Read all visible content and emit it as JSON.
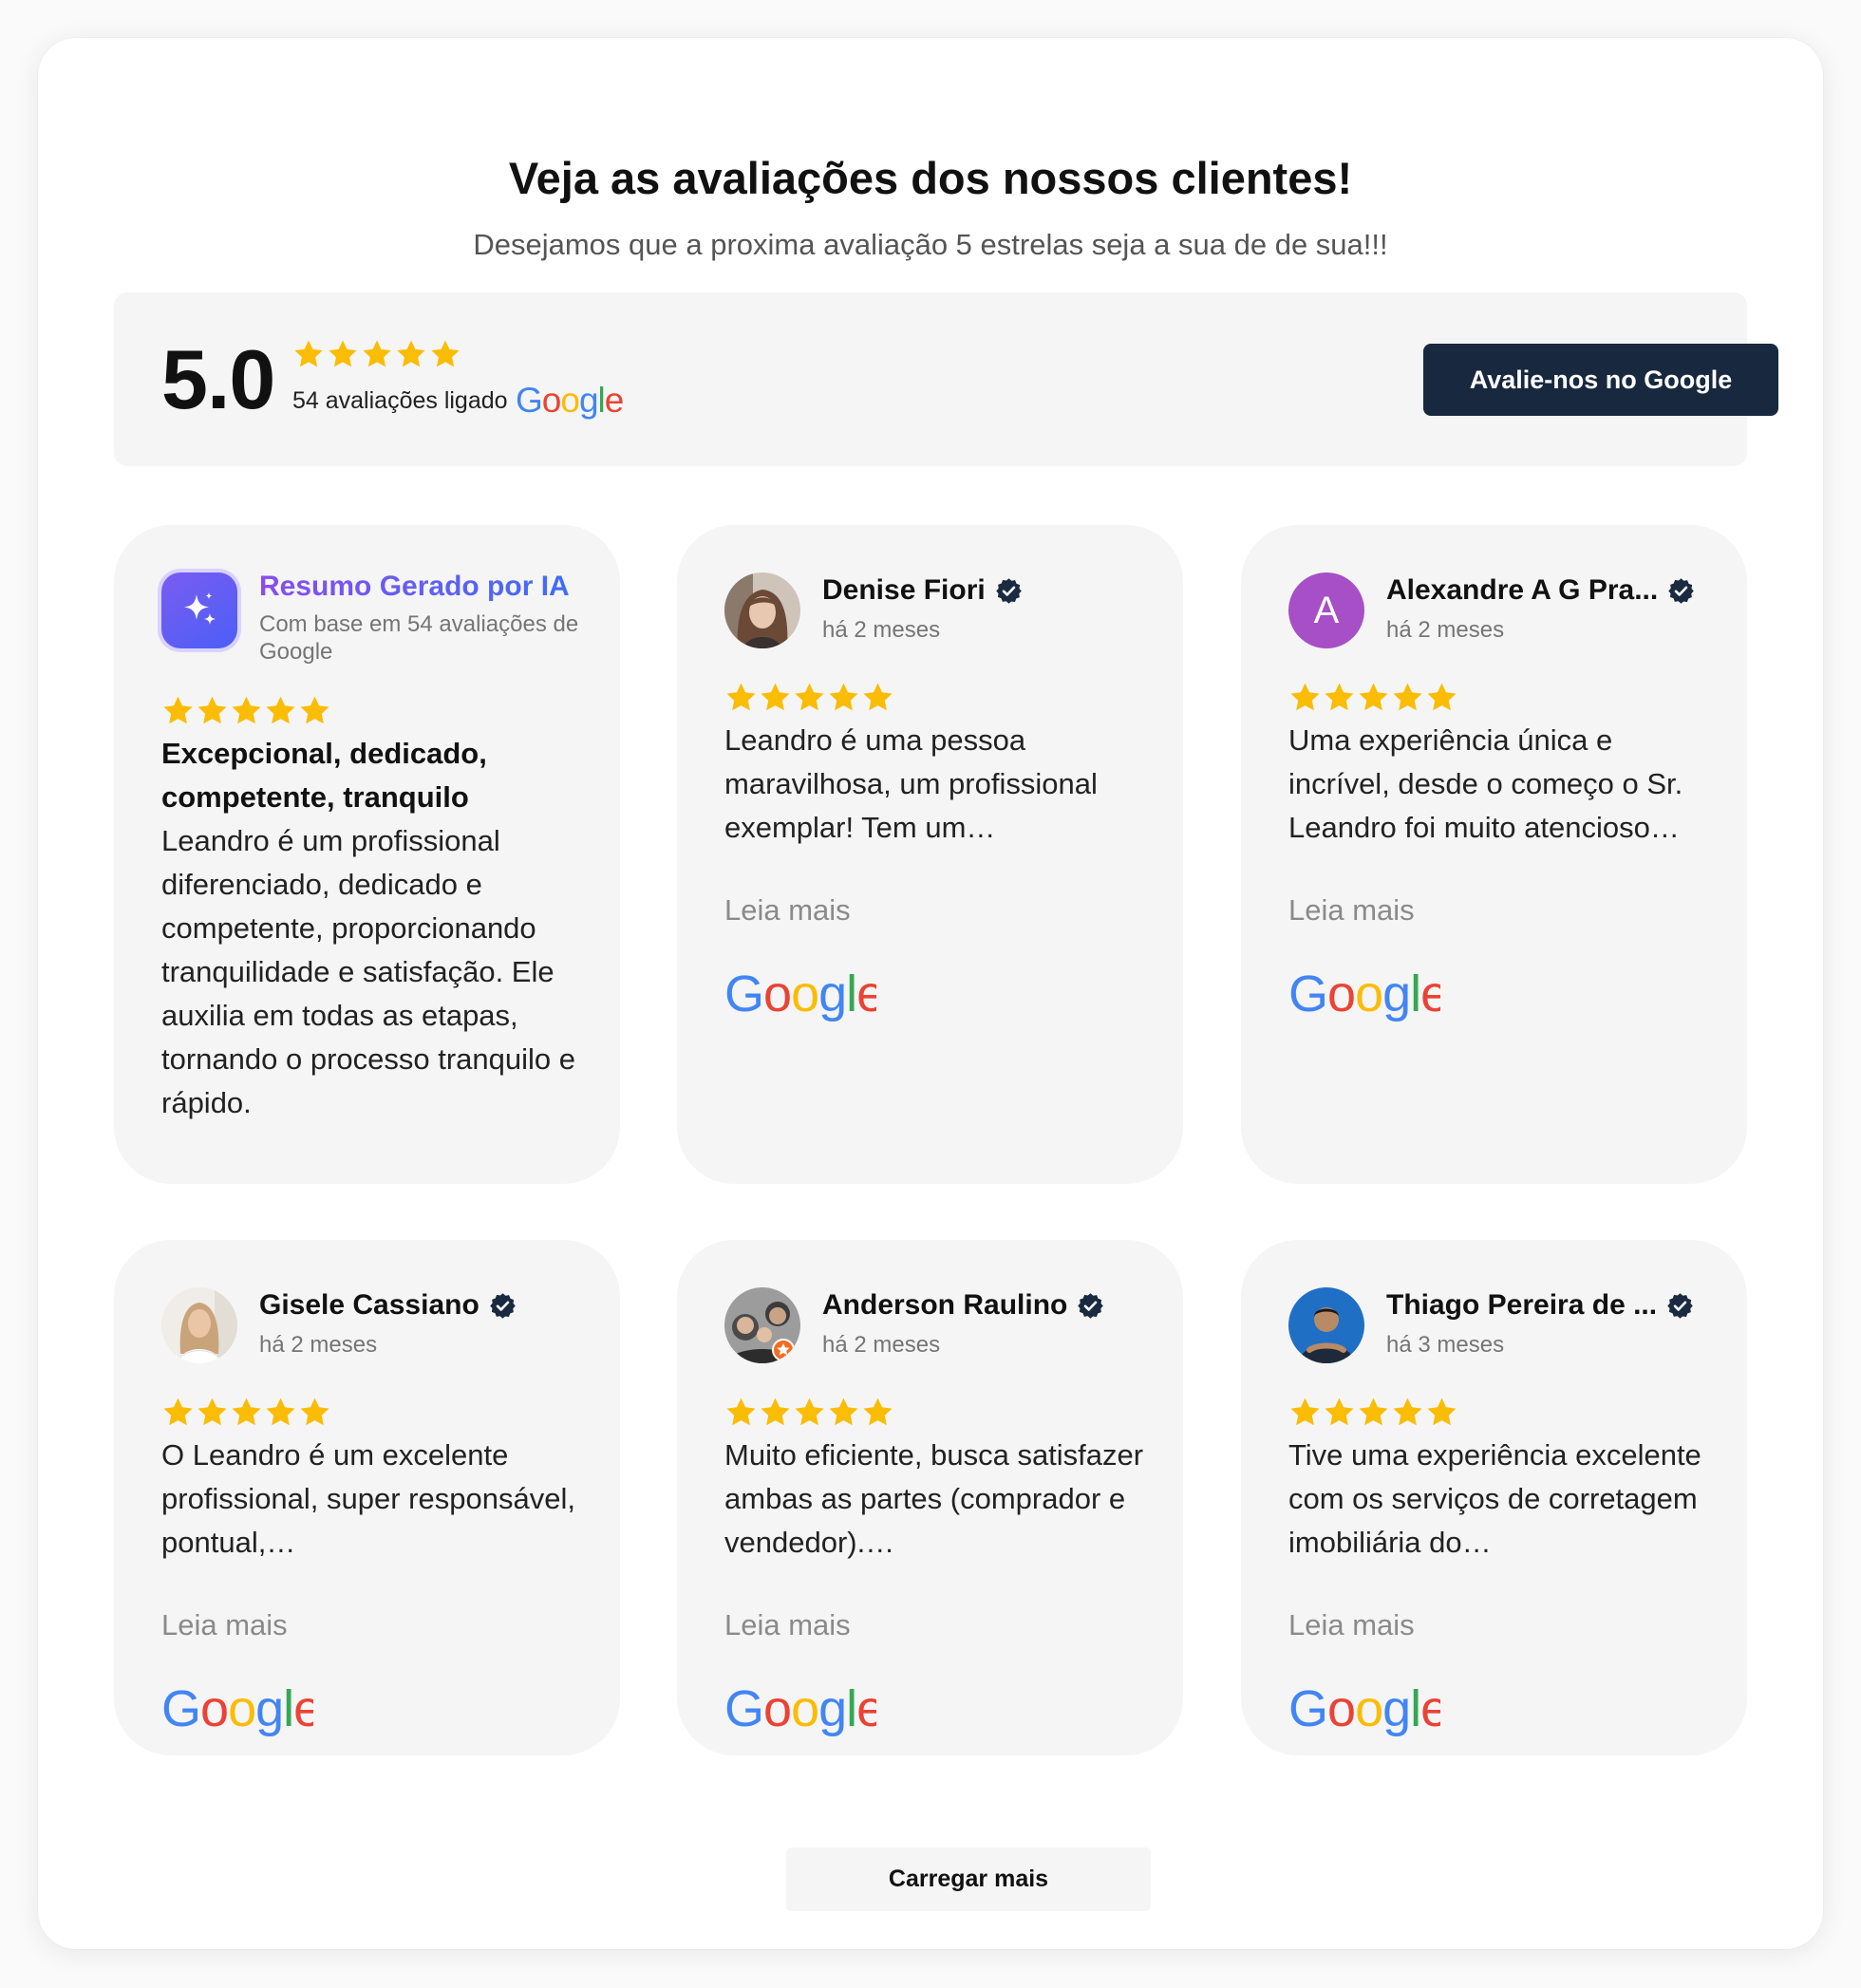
{
  "header": {
    "title": "Veja as avaliações dos nossos clientes!",
    "subtitle": "Desejamos que a proxima avaliação 5 estrelas seja a sua de de sua!!!"
  },
  "summary": {
    "rating": "5.0",
    "stars": 5,
    "count_text": "54 avaliações ligado",
    "platform": "Google",
    "cta_label": "Avalie-nos no Google"
  },
  "ai_summary": {
    "title": "Resumo Gerado por IA",
    "subtitle": "Com base em 54 avaliações de Google",
    "stars": 5,
    "headline": "Excepcional, dedicado, competente, tranquilo",
    "body": "Leandro é um profissional diferenciado, dedicado e competente, proporcionando tranquilidade e satisfação. Ele auxilia em todas as etapas, tornando o processo tranquilo e rápido."
  },
  "reviews": [
    {
      "name": "Denise Fiori",
      "date": "há 2 meses",
      "stars": 5,
      "text": "Leandro é uma pessoa maravilhosa, um profissional exemplar! Tem um…",
      "read_more": "Leia mais",
      "avatar": "photo-woman-brown-hair",
      "verified": true
    },
    {
      "name": "Alexandre A G Pra...",
      "date": "há 2 meses",
      "stars": 5,
      "text": "Uma experiência única e incrível, desde o começo o Sr. Leandro foi muito atencioso…",
      "read_more": "Leia mais",
      "avatar_letter": "A",
      "avatar_color": "#a64fc7",
      "verified": true
    },
    {
      "name": "Gisele Cassiano",
      "date": "há 2 meses",
      "stars": 5,
      "text": "O Leandro é um excelente profissional, super responsável, pontual,…",
      "read_more": "Leia mais",
      "avatar": "photo-woman-smiling",
      "verified": true
    },
    {
      "name": "Anderson Raulino",
      "date": "há 2 meses",
      "stars": 5,
      "text": "Muito eficiente, busca satisfazer ambas as partes (comprador e vendedor).…",
      "read_more": "Leia mais",
      "avatar": "photo-family",
      "verified": true
    },
    {
      "name": "Thiago Pereira de ...",
      "date": "há 3 meses",
      "stars": 5,
      "text": "Tive uma experiência excelente com os serviços de corretagem imobiliária do…",
      "read_more": "Leia mais",
      "avatar": "photo-man-blue-background",
      "verified": true
    }
  ],
  "load_more_label": "Carregar mais",
  "colors": {
    "star": "#fbbc04",
    "cta_bg": "#17283f",
    "card_bg": "#f5f5f5",
    "google_blue": "#4285f4",
    "google_red": "#ea4335",
    "google_yellow": "#fbbc05",
    "google_green": "#34a853",
    "verified": "#1a2a40",
    "ai_gradient_start": "#8a4cf0",
    "ai_gradient_end": "#3f6ef5"
  }
}
